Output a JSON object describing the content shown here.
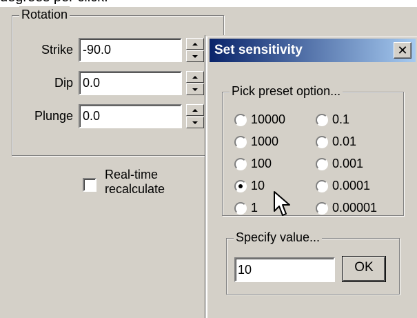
{
  "caption": {
    "text": "degrees per click."
  },
  "rotation": {
    "legend": "Rotation",
    "fields": [
      {
        "label": "Strike",
        "value": "-90.0"
      },
      {
        "label": "Dip",
        "value": "0.0"
      },
      {
        "label": "Plunge",
        "value": "0.0"
      }
    ],
    "realtime": {
      "label_line1": "Real-time",
      "label_line2": "recalculate",
      "checked": false
    }
  },
  "dialog": {
    "title": "Set sensitivity",
    "close_icon": "close-icon",
    "preset": {
      "legend": "Pick preset option...",
      "options_left": [
        "10000",
        "1000",
        "100",
        "10",
        "1"
      ],
      "options_right": [
        "0.1",
        "0.01",
        "0.001",
        "0.0001",
        "0.00001"
      ],
      "selected": "10"
    },
    "specify": {
      "legend": "Specify value...",
      "value": "10",
      "ok_label": "OK"
    }
  },
  "cursor_icon": "arrow-pointer-icon",
  "colors": {
    "face": "#d4d0c8",
    "titlebar_start": "#0a246a",
    "titlebar_end": "#a6caf0"
  }
}
